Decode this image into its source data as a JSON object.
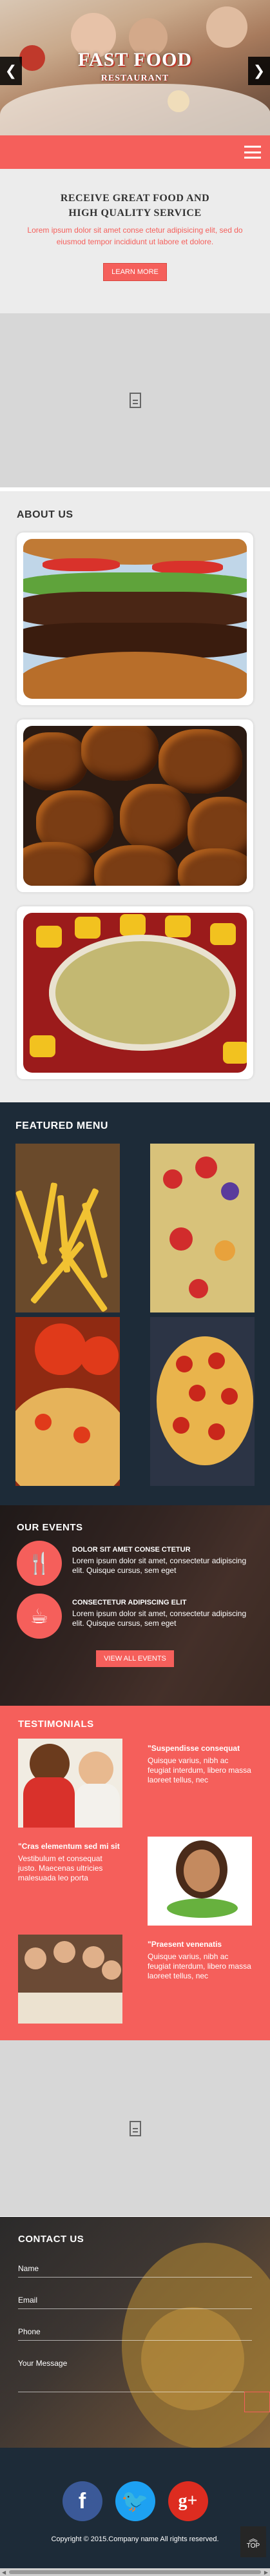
{
  "hero": {
    "title": "FAST FOOD",
    "subtitle": "RESTAURANT",
    "prev_arrow": "❮",
    "next_arrow": "❯"
  },
  "intro": {
    "heading": "RECEIVE GREAT FOOD AND HIGH QUALITY SERVICE",
    "text": "Lorem ipsum dolor sit amet conse ctetur adipisicing elit, sed do eiusmod tempor incididunt ut labore et dolore.",
    "button": "LEARN MORE"
  },
  "about": {
    "title": "ABOUT US"
  },
  "featured": {
    "title": "FEATURED MENU"
  },
  "events": {
    "title": "OUR EVENTS",
    "items": [
      {
        "icon": "fork-knife-icon",
        "glyph": "🍴",
        "heading": "DOLOR SIT AMET CONSE CTETUR",
        "text": "Lorem ipsum dolor sit amet, consectetur adipiscing elit. Quisque cursus, sem eget"
      },
      {
        "icon": "coffee-cup-icon",
        "glyph": "☕",
        "heading": "CONSECTETUR ADIPISCING ELIT",
        "text": "Lorem ipsum dolor sit amet, consectetur adipiscing elit. Quisque cursus, sem eget"
      }
    ],
    "button": "VIEW ALL EVENTS"
  },
  "testimonials": {
    "title": "TESTIMONIALS",
    "items": [
      {
        "quote": "\"Suspendisse consequat",
        "text": "Quisque varius, nibh ac feugiat interdum, libero massa laoreet tellus, nec"
      },
      {
        "quote": "\"Cras elementum sed mi sit",
        "text": "Vestibulum et consequat justo. Maecenas ultricies malesuada leo porta"
      },
      {
        "quote": "\"Praesent venenatis",
        "text": "Quisque varius, nibh ac feugiat interdum, libero massa laoreet tellus, nec"
      }
    ]
  },
  "contact": {
    "title": "CONTACT US",
    "name_placeholder": "Name",
    "email_placeholder": "Email",
    "phone_placeholder": "Phone",
    "message_placeholder": "Your Message"
  },
  "footer": {
    "facebook": "f",
    "twitter": "🐦",
    "googleplus": "g+",
    "copyright": "Copyright © 2015.Company name All rights reserved.",
    "top_label": "TOP",
    "top_chevron": "︽"
  },
  "scrollbar": {
    "left": "◀",
    "right": "▶"
  },
  "colors": {
    "accent": "#f55f5b",
    "dark": "#1d2b38",
    "light": "#ececec"
  }
}
